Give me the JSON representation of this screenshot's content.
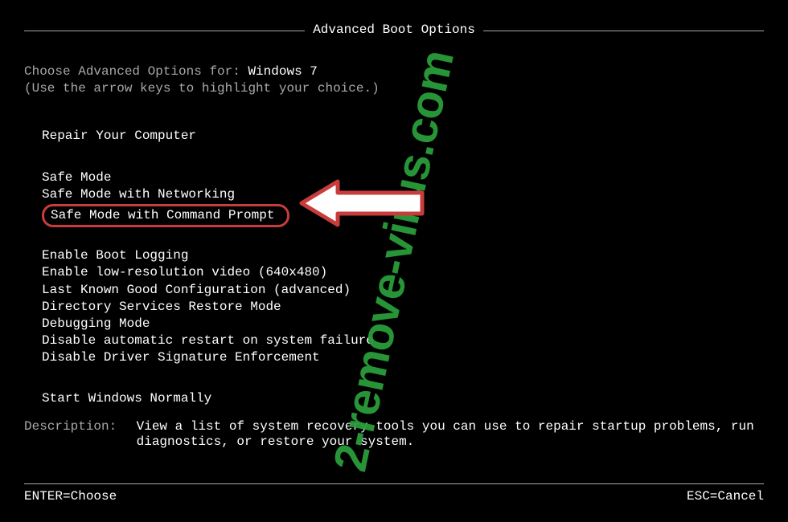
{
  "title": "Advanced Boot Options",
  "choose_prefix": "Choose Advanced Options for: ",
  "os_name": "Windows 7",
  "hint": "(Use the arrow keys to highlight your choice.)",
  "group1": {
    "items": [
      "Repair Your Computer"
    ]
  },
  "group2": {
    "items": [
      "Safe Mode",
      "Safe Mode with Networking",
      "Safe Mode with Command Prompt"
    ],
    "highlighted_index": 2
  },
  "group3": {
    "items": [
      "Enable Boot Logging",
      "Enable low-resolution video (640x480)",
      "Last Known Good Configuration (advanced)",
      "Directory Services Restore Mode",
      "Debugging Mode",
      "Disable automatic restart on system failure",
      "Disable Driver Signature Enforcement"
    ]
  },
  "group4": {
    "items": [
      "Start Windows Normally"
    ]
  },
  "description": {
    "label": "Description:",
    "text": "View a list of system recovery tools you can use to repair startup problems, run diagnostics, or restore your system."
  },
  "footer": {
    "left": "ENTER=Choose",
    "right": "ESC=Cancel"
  },
  "watermark": "2-remove-virus.com"
}
